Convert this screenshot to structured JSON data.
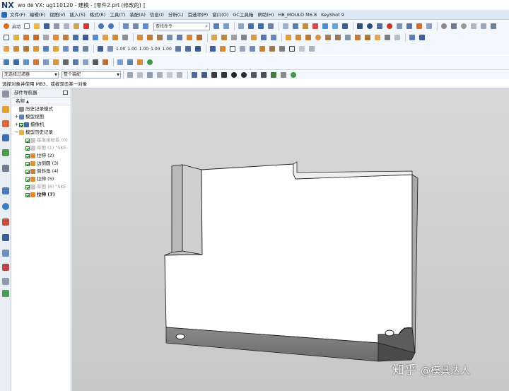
{
  "window": {
    "logo": "NX",
    "title": "wo de VX:  ug110120 - 建模 - [零件2.prt  (修改的)  ]"
  },
  "menubar": {
    "items": [
      "文件(F)",
      "编辑(E)",
      "视图(V)",
      "插入(S)",
      "格式(R)",
      "工具(T)",
      "装配(A)",
      "信息(I)",
      "分析(L)",
      "首选项(P)",
      "窗口(O)",
      "GC工具箱",
      "帮助(H)",
      "HB_MOULD M6.8",
      "KeyShot 9"
    ]
  },
  "toolbar": {
    "start_label": "启动",
    "search_placeholder": "查找命令",
    "row3_values": [
      "1.00",
      "1.00",
      "1.00",
      "1.00",
      "1.00"
    ]
  },
  "selection_bar": {
    "filter": "无选择过滤器",
    "scope": "整个装配"
  },
  "status_line": "选择对象并使用 MB3，或者双击某一对象",
  "navigator": {
    "title": "部件导航器",
    "column": "名称",
    "nodes": [
      {
        "label": "历史记录模式",
        "icon": "history-mode-icon",
        "indent": 0,
        "expand": "",
        "check": false,
        "style": "normal"
      },
      {
        "label": "模型视图",
        "icon": "model-views-icon",
        "indent": 0,
        "expand": "+",
        "check": false,
        "style": "normal"
      },
      {
        "label": "摄像机",
        "icon": "camera-icon",
        "indent": 0,
        "expand": "+",
        "check": true,
        "style": "normal"
      },
      {
        "label": "模型历史记录",
        "icon": "folder-icon",
        "indent": 0,
        "expand": "−",
        "check": false,
        "style": "normal"
      },
      {
        "label": "基准坐标系 (0)",
        "icon": "datum-csys-icon",
        "indent": 1,
        "expand": "",
        "check": true,
        "style": "gray"
      },
      {
        "label": "草图 (1) \"SKE",
        "icon": "sketch-icon",
        "indent": 1,
        "expand": "",
        "check": true,
        "style": "gray"
      },
      {
        "label": "拉伸 (2)",
        "icon": "extrude-icon",
        "indent": 1,
        "expand": "",
        "check": true,
        "style": "normal"
      },
      {
        "label": "边倒圆 (3)",
        "icon": "edge-blend-icon",
        "indent": 1,
        "expand": "",
        "check": true,
        "style": "normal"
      },
      {
        "label": "倒斜角 (4)",
        "icon": "chamfer-icon",
        "indent": 1,
        "expand": "",
        "check": true,
        "style": "normal"
      },
      {
        "label": "拉伸 (5)",
        "icon": "extrude-icon",
        "indent": 1,
        "expand": "",
        "check": true,
        "style": "normal"
      },
      {
        "label": "草图 (6) \"SKE",
        "icon": "sketch-icon",
        "indent": 1,
        "expand": "",
        "check": true,
        "style": "gray"
      },
      {
        "label": "拉伸 (7)",
        "icon": "extrude-icon",
        "indent": 1,
        "expand": "",
        "check": true,
        "style": "bold"
      }
    ]
  },
  "watermark": {
    "brand": "知乎",
    "author": "@模具达人"
  },
  "colors": {
    "menubar_bg": "#dde8f5",
    "viewport_bg": "#cfcfcf",
    "model_face": "#ffffff",
    "model_side": "#7c7c7c",
    "model_edge": "#1a1a1a"
  }
}
